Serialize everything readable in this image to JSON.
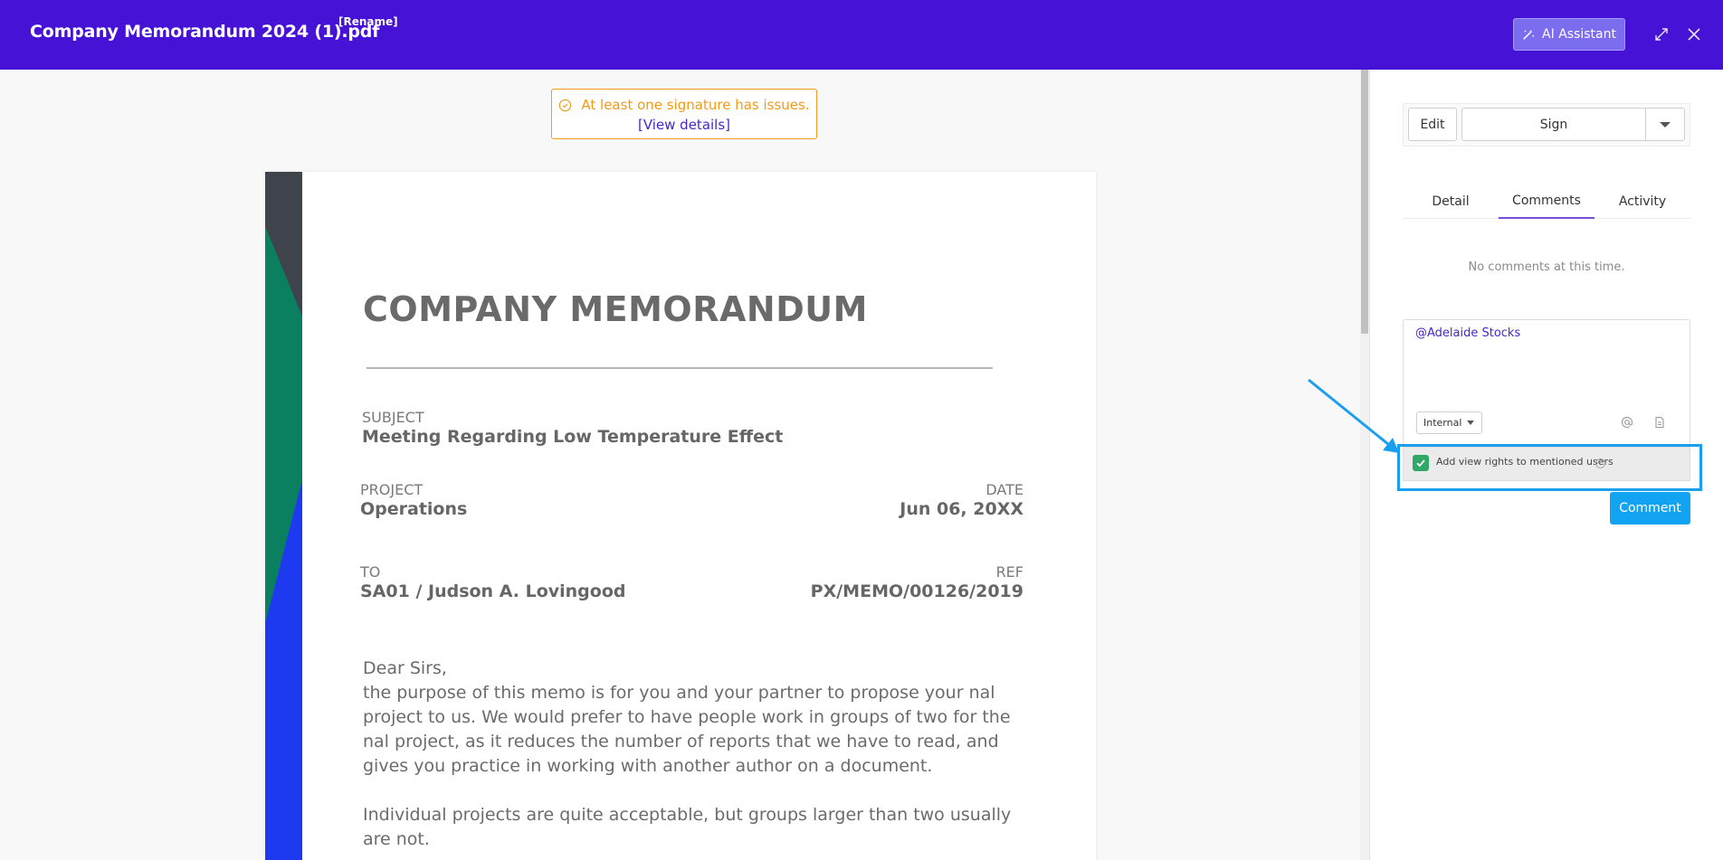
{
  "header": {
    "title": "Company Memorandum 2024 (1).pdf",
    "rename_label": "[Rename]",
    "ai_assistant_label": "AI Assistant"
  },
  "viewer": {
    "warning_text": "At least one signature has issues.",
    "view_details_label": "[View details]"
  },
  "document": {
    "title": "COMPANY MEMORANDUM",
    "subject_label": "SUBJECT",
    "subject_value": "Meeting Regarding Low Temperature Effect",
    "project_label": "PROJECT",
    "project_value": "Operations",
    "date_label": "DATE",
    "date_value": "Jun 06, 20XX",
    "to_label": "TO",
    "to_value": "SA01 / Judson A. Lovingood",
    "ref_label": "REF",
    "ref_value": "PX/MEMO/00126/2019",
    "greeting": "Dear Sirs,",
    "paragraph1": "the purpose of this memo is for you and your partner to propose your nal project to us. We would prefer to have people work in groups of two for the nal project, as it reduces the number of reports that we have to read, and gives you practice in working with another author on a document.",
    "paragraph2": "Individual projects are quite acceptable, but groups larger than two usually are not."
  },
  "sidebar": {
    "edit_label": "Edit",
    "sign_label": "Sign",
    "tabs": [
      {
        "label": "Detail"
      },
      {
        "label": "Comments"
      },
      {
        "label": "Activity"
      }
    ],
    "active_tab": "Comments",
    "no_comments_text": "No comments at this time.",
    "comment_input_value": "@Adelaide Stocks",
    "visibility_select": "Internal",
    "add_view_rights_label": "Add view rights to mentioned users",
    "add_view_rights_checked": true,
    "comment_button_label": "Comment"
  },
  "colors": {
    "header_bg": "#4512d6",
    "accent_blue": "#12a4f2",
    "warning": "#f29a17",
    "checkbox_green": "#2fa868",
    "highlight": "#1a9fef"
  }
}
